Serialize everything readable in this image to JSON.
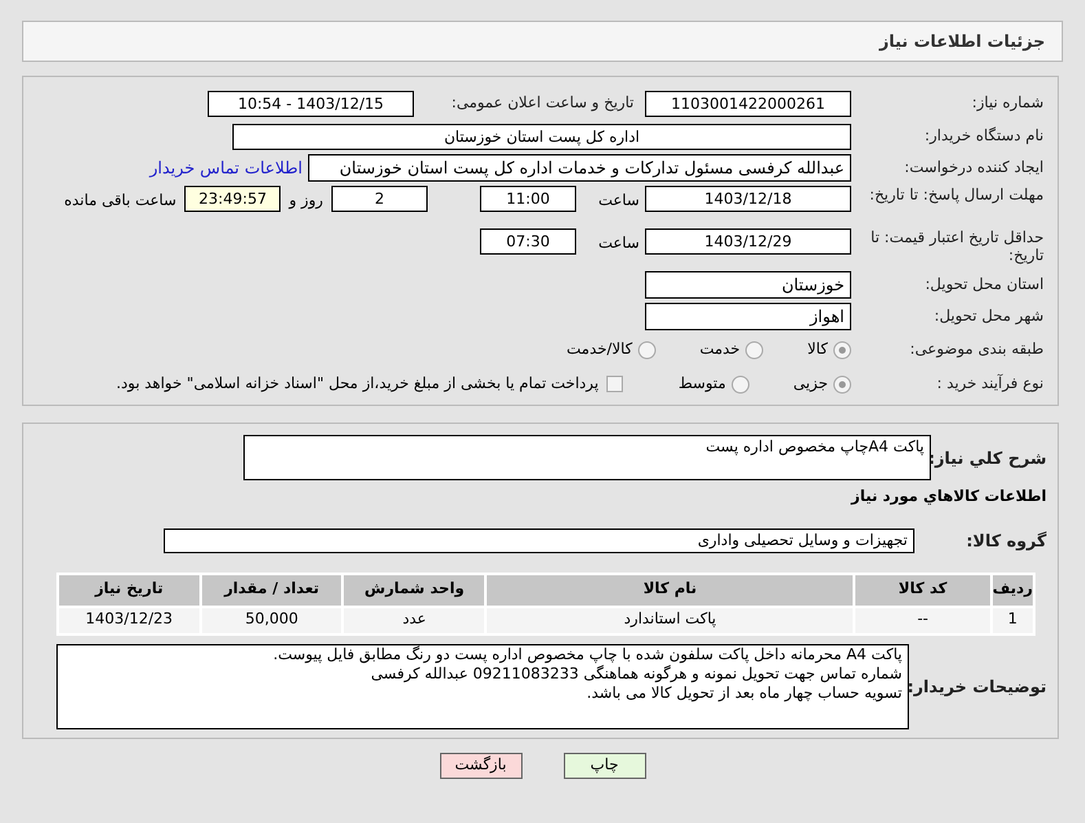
{
  "header": {
    "title": "جزئیات اطلاعات نیاز"
  },
  "fields": {
    "need_number": {
      "label": "شماره نیاز:",
      "value": "1103001422000261"
    },
    "announce": {
      "label": "تاریخ و ساعت اعلان عمومی:",
      "value": "1403/12/15 - 10:54"
    },
    "buyer": {
      "label": "نام دستگاه خریدار:",
      "value": "اداره کل پست استان خوزستان"
    },
    "requester": {
      "label": "ایجاد کننده درخواست:",
      "value": "عبدالله کرفسی مسئول تدارکات و خدمات اداره کل پست استان خوزستان",
      "link": "اطلاعات تماس خریدار"
    },
    "deadline": {
      "label": "مهلت ارسال پاسخ: تا تاریخ:",
      "date": "1403/12/18",
      "time_label": "ساعت",
      "time": "11:00",
      "days": "2",
      "days_label": "روز و",
      "remaining": "23:49:57",
      "remaining_label": "ساعت باقی مانده"
    },
    "validity": {
      "label": "حداقل تاریخ اعتبار قیمت: تا تاریخ:",
      "date": "1403/12/29",
      "time_label": "ساعت",
      "time": "07:30"
    },
    "province": {
      "label": "استان محل تحویل:",
      "value": "خوزستان"
    },
    "city": {
      "label": "شهر محل تحویل:",
      "value": "اهواز"
    },
    "category": {
      "label": "طبقه بندی موضوعی:",
      "options": [
        {
          "label": "کالا",
          "selected": true
        },
        {
          "label": "خدمت",
          "selected": false
        },
        {
          "label": "کالا/خدمت",
          "selected": false
        }
      ]
    },
    "process": {
      "label": "نوع فرآیند خرید :",
      "options": [
        {
          "label": "جزیی",
          "selected": true
        },
        {
          "label": "متوسط",
          "selected": false
        }
      ],
      "payment": {
        "label": "پرداخت تمام یا بخشی از مبلغ خرید،از محل \"اسناد خزانه اسلامی\" خواهد بود.",
        "checked": false
      }
    }
  },
  "details": {
    "description": {
      "label": "شرح کلي نیاز:",
      "value": "پاکت A4چاپ مخصوص اداره پست"
    },
    "goods_heading": "اطلاعات کالاهاي مورد نياز",
    "goods_group": {
      "label": "گروه کالا:",
      "value": "تجهیزات و وسایل تحصیلی واداری"
    },
    "table": {
      "columns": [
        "ردیف",
        "کد کالا",
        "نام کالا",
        "واحد شمارش",
        "تعداد / مقدار",
        "تاریخ نیاز"
      ],
      "rows": [
        [
          "1",
          "--",
          "پاکت استاندارد",
          "عدد",
          "50,000",
          "1403/12/23"
        ]
      ]
    },
    "notes": {
      "label": "توضیحات خریدار:",
      "lines": [
        "پاکت A4 محرمانه داخل پاکت سلفون شده با چاپ مخصوص اداره پست دو رنگ  مطابق فایل پیوست.",
        "شماره تماس جهت تحویل نمونه و هرگونه هماهنگی 09211083233 عبدالله کرفسی",
        "تسویه حساب چهار ماه بعد از تحویل کالا می باشد."
      ]
    }
  },
  "buttons": [
    {
      "label": "چاپ",
      "kind": "print"
    },
    {
      "label": "بازگشت",
      "kind": "back"
    }
  ]
}
